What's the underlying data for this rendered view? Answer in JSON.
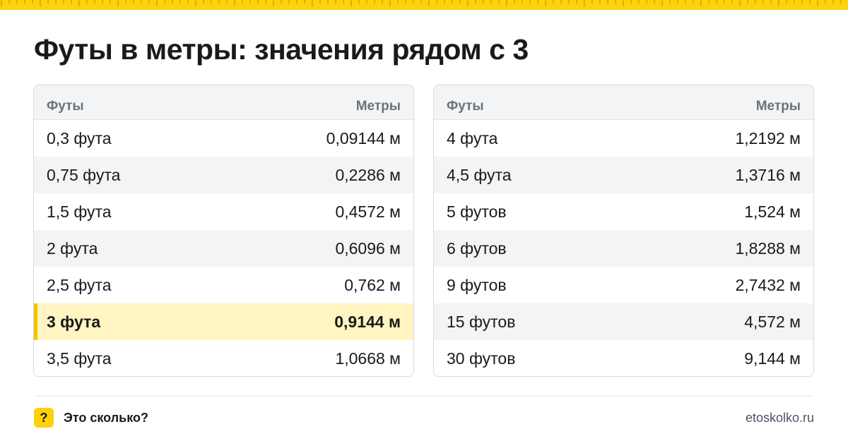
{
  "title": "Футы в метры: значения рядом с 3",
  "colors": {
    "accent": "#fdd10b",
    "highlight_bg": "#fff4c2",
    "header_bg": "#f3f4f6",
    "muted_text": "#6b7280"
  },
  "tables": [
    {
      "header": {
        "col1": "Футы",
        "col2": "Метры"
      },
      "rows": [
        {
          "feet": "0,3 фута",
          "meters": "0,09144 м"
        },
        {
          "feet": "0,75 фута",
          "meters": "0,2286 м"
        },
        {
          "feet": "1,5 фута",
          "meters": "0,4572 м"
        },
        {
          "feet": "2 фута",
          "meters": "0,6096 м"
        },
        {
          "feet": "2,5 фута",
          "meters": "0,762 м"
        },
        {
          "feet": "3 фута",
          "meters": "0,9144 м",
          "highlighted": true
        },
        {
          "feet": "3,5 фута",
          "meters": "1,0668 м"
        }
      ]
    },
    {
      "header": {
        "col1": "Футы",
        "col2": "Метры"
      },
      "rows": [
        {
          "feet": "4 фута",
          "meters": "1,2192 м"
        },
        {
          "feet": "4,5 фута",
          "meters": "1,3716 м"
        },
        {
          "feet": "5 футов",
          "meters": "1,524 м"
        },
        {
          "feet": "6 футов",
          "meters": "1,8288 м"
        },
        {
          "feet": "9 футов",
          "meters": "2,7432 м"
        },
        {
          "feet": "15 футов",
          "meters": "4,572 м"
        },
        {
          "feet": "30 футов",
          "meters": "9,144 м"
        }
      ]
    }
  ],
  "footer": {
    "badge_icon": "question-mark-icon",
    "badge_text": "?",
    "brand": "Это сколько?",
    "site": "etoskolko.ru"
  }
}
